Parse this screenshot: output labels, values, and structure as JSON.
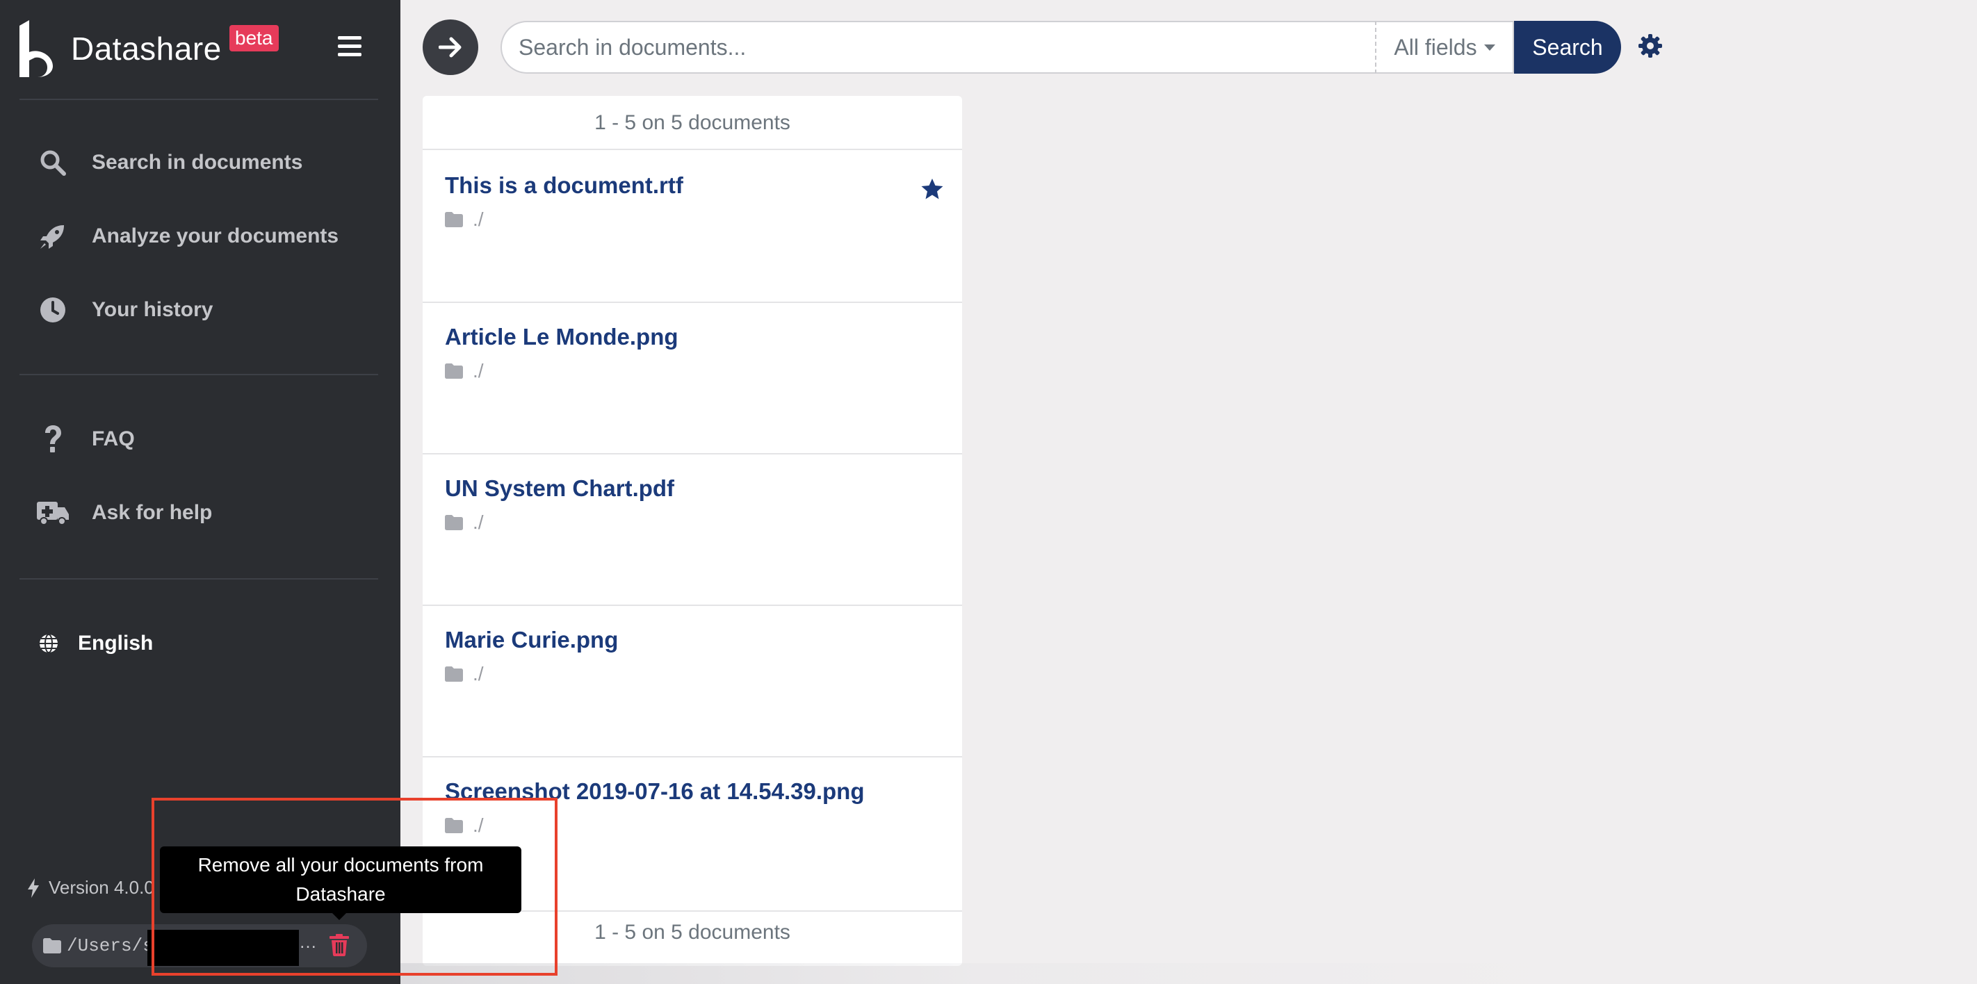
{
  "sidebar": {
    "brand": "Datashare",
    "beta": "beta",
    "nav": [
      {
        "label": "Search in documents",
        "icon": "search-icon"
      },
      {
        "label": "Analyze your documents",
        "icon": "rocket-icon"
      },
      {
        "label": "Your history",
        "icon": "clock-icon"
      }
    ],
    "help": [
      {
        "label": "FAQ",
        "icon": "question-icon"
      },
      {
        "label": "Ask for help",
        "icon": "ambulance-icon"
      }
    ],
    "language": "English",
    "version": "Version 4.0.0",
    "path": "/Users/s",
    "path_ellipsis": "…"
  },
  "tooltip": {
    "line1": "Remove all your documents from",
    "line2": "Datashare"
  },
  "search": {
    "placeholder": "Search in documents...",
    "field": "All fields",
    "button": "Search"
  },
  "results": {
    "summary": "1 - 5  on 5 documents",
    "documents": [
      {
        "title": "This is a document.rtf",
        "path": "./",
        "starred": true
      },
      {
        "title": "Article Le Monde.png",
        "path": "./",
        "starred": false
      },
      {
        "title": "UN System Chart.pdf",
        "path": "./",
        "starred": false
      },
      {
        "title": "Marie Curie.png",
        "path": "./",
        "starred": false
      },
      {
        "title": "Screenshot 2019-07-16 at 14.54.39.png",
        "path": "./",
        "starred": false
      }
    ]
  },
  "colors": {
    "sidebar_bg": "#2b2d31",
    "primary": "#1b3364",
    "beta": "#e63b5a",
    "trash": "#e63b5a",
    "highlight": "#e8412c",
    "link": "#1b3a7a"
  }
}
